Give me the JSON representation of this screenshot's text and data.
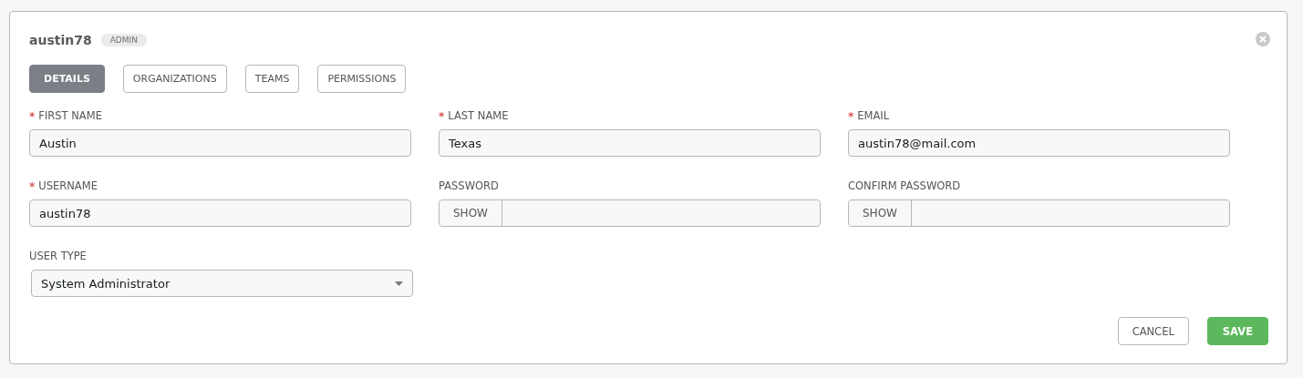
{
  "header": {
    "title": "austin78",
    "badge": "ADMIN"
  },
  "tabs": [
    {
      "label": "DETAILS",
      "selected": true
    },
    {
      "label": "ORGANIZATIONS",
      "selected": false
    },
    {
      "label": "TEAMS",
      "selected": false
    },
    {
      "label": "PERMISSIONS",
      "selected": false
    }
  ],
  "fields": [
    {
      "kind": "text",
      "required_marker": "*",
      "label": "FIRST NAME",
      "value": "Austin"
    },
    {
      "kind": "text",
      "required_marker": "*",
      "label": "LAST NAME",
      "value": "Texas"
    },
    {
      "kind": "text",
      "required_marker": "*",
      "label": "EMAIL",
      "value": "austin78@mail.com"
    },
    {
      "kind": "text",
      "required_marker": "*",
      "label": "USERNAME",
      "value": "austin78"
    },
    {
      "kind": "password",
      "label": "PASSWORD",
      "toggle": "SHOW"
    },
    {
      "kind": "password",
      "label": "CONFIRM PASSWORD",
      "toggle": "SHOW"
    },
    {
      "kind": "select",
      "label": "USER TYPE",
      "value": "System Administrator"
    }
  ],
  "buttons": [
    {
      "kind": "secondary",
      "label": "CANCEL"
    },
    {
      "kind": "primary",
      "label": "SAVE"
    }
  ]
}
